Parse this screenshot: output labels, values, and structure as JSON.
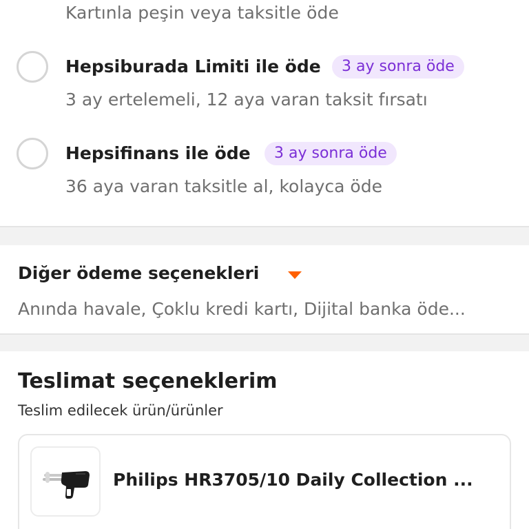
{
  "payment": {
    "top_subtitle": "Kartınla peşin veya taksitle öde",
    "options": [
      {
        "title": "Hepsiburada Limiti ile öde",
        "badge": "3 ay sonra öde",
        "subtitle": "3 ay ertelemeli, 12 aya varan taksit fırsatı",
        "selected": false
      },
      {
        "title": "Hepsifinans ile öde",
        "badge": "3 ay sonra öde",
        "subtitle": "36 aya varan taksitle al, kolayca öde",
        "selected": false
      }
    ]
  },
  "other_payments": {
    "title": "Diğer ödeme seçenekleri",
    "subtitle": "Anında havale, Çoklu kredi kartı, Dijital banka öde...",
    "icon": "caret-down-icon"
  },
  "delivery": {
    "title": "Teslimat seçeneklerim",
    "subtitle": "Teslim edilecek ürün/ürünler",
    "product": {
      "name": "Philips HR3705/10 Daily Collection ...",
      "image": "hand-mixer-image"
    }
  },
  "colors": {
    "accent_orange": "#ff6000",
    "badge_bg": "#f1e7fd",
    "badge_text": "#7b2fd6",
    "muted_text": "#6f6f6f"
  }
}
